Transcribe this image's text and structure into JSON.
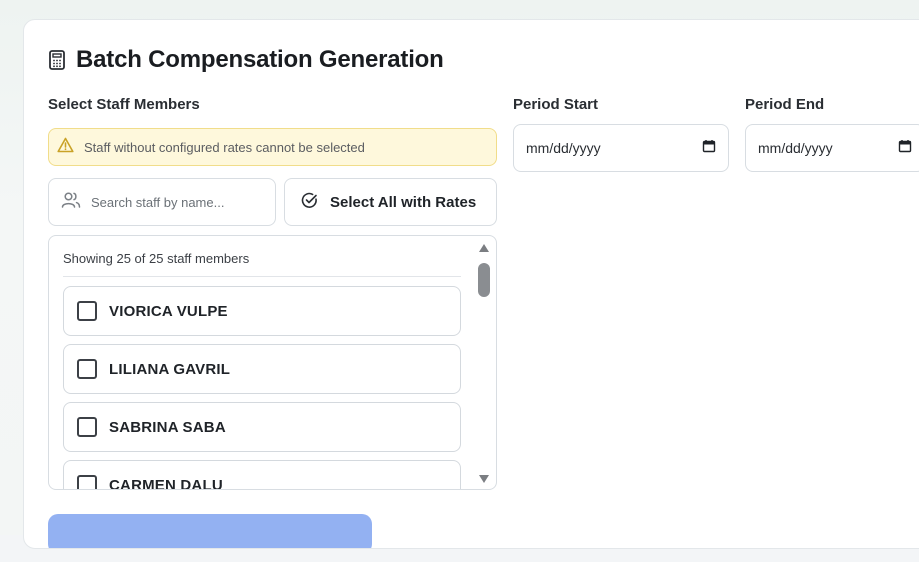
{
  "page": {
    "title": "Batch Compensation Generation",
    "title_icon": "calculator-icon"
  },
  "staff_section": {
    "label": "Select Staff Members",
    "warning": {
      "icon": "warning-triangle-icon",
      "text": "Staff without configured rates cannot be selected"
    },
    "search": {
      "icon": "users-icon",
      "placeholder": "Search staff by name...",
      "value": ""
    },
    "select_all": {
      "icon": "check-circle-icon",
      "label": "Select All with Rates"
    },
    "list": {
      "showing_text": "Showing 25 of 25 staff members",
      "items": [
        {
          "name": "VIORICA VULPE",
          "checked": false
        },
        {
          "name": "LILIANA GAVRIL",
          "checked": false
        },
        {
          "name": "SABRINA SABA",
          "checked": false
        },
        {
          "name": "CARMEN DALU",
          "checked": false
        }
      ]
    }
  },
  "period": {
    "start": {
      "label": "Period Start",
      "value": "mm/dd/yyyy",
      "icon": "calendar-icon"
    },
    "end": {
      "label": "Period End",
      "value": "mm/dd/yyyy",
      "icon": "calendar-icon"
    }
  },
  "colors": {
    "warning_bg": "#fef8dc",
    "warning_border": "#f1dd8a",
    "warning_icon": "#c9a227",
    "primary_disabled": "#93b1f2"
  }
}
